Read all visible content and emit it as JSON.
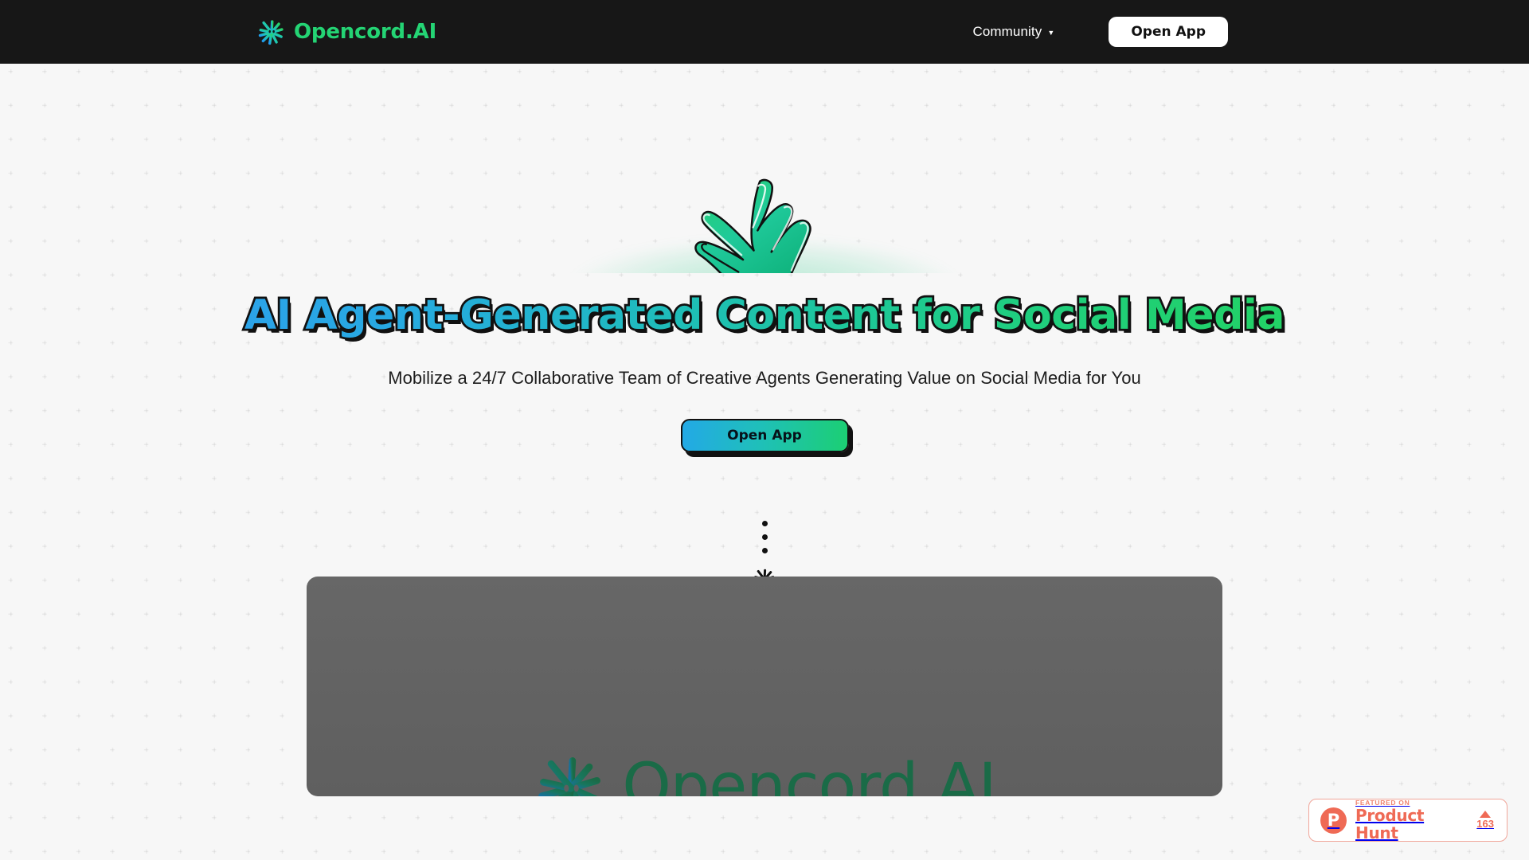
{
  "header": {
    "logo_icon": "opencord-spark-icon",
    "brand_name": "Opencord.AI",
    "nav": {
      "community_label": "Community",
      "community_caret": "▼",
      "open_app_label": "Open App"
    }
  },
  "hero": {
    "art_icon": "green-hand-illustration",
    "headline": "AI Agent-Generated Content for Social Media",
    "subheadline": "Mobilize a 24/7 Collaborative Team of Creative Agents Generating Value on Social Media for You",
    "cta_label": "Open App",
    "connector": {
      "dot_count": 3,
      "spark_icon": "opencord-spark-icon"
    }
  },
  "video_card": {
    "logo_icon": "opencord-spark-icon",
    "brand_name": "Opencord.AI"
  },
  "product_hunt": {
    "mark": "P",
    "kicker": "FEATURED ON",
    "name": "Product Hunt",
    "upvote_arrow": "▲",
    "votes": "163"
  },
  "colors": {
    "header_bg": "#171717",
    "page_bg": "#f7f7f7",
    "brand_green": "#24d474",
    "accent_blue": "#2ba3e8",
    "accent_green": "#22d266",
    "card_gray": "#626262",
    "product_hunt": "#ef6a55"
  }
}
